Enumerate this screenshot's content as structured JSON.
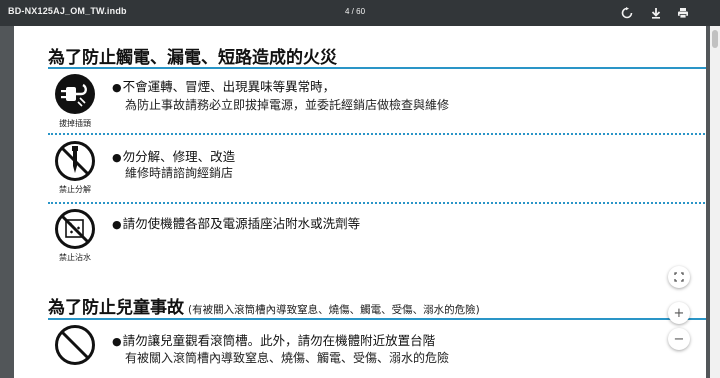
{
  "toolbar": {
    "doc_title": "BD-NX125AJ_OM_TW.indb",
    "page_indicator": "4 / 60",
    "rotate_icon": "rotate-icon",
    "download_icon": "download-icon",
    "print_icon": "print-icon"
  },
  "page": {
    "section1": {
      "heading": "為了防止觸電、漏電、短路造成的火災",
      "items": [
        {
          "icon": "unplug-icon",
          "icon_label": "拔掉插頭",
          "bullet": "●",
          "line1": "不會運轉、冒煙、出現異味等異常時，",
          "line2": "為防止事故請務必立即拔掉電源，並委託經銷店做檢查與維修"
        },
        {
          "icon": "no-disassembly-icon",
          "icon_label": "禁止分解",
          "bullet": "●",
          "line1": "勿分解、修理、改造",
          "line2": "維修時請諮詢經銷店"
        },
        {
          "icon": "no-water-icon",
          "icon_label": "禁止沾水",
          "bullet": "●",
          "line1": "請勿使機體各部及電源插座沾附水或洗劑等",
          "line2": ""
        }
      ]
    },
    "section2": {
      "heading": "為了防止兒童事故",
      "heading_note": "(有被關入滾筒槽內導致窒息、燒傷、觸電、受傷、溺水的危險)",
      "items": [
        {
          "icon": "prohibited-icon",
          "bullet": "●",
          "line1": "請勿讓兒童觀看滾筒槽。此外，請勿在機體附近放置台階",
          "line2": "有被關入滾筒槽內導致窒息、燒傷、觸電、受傷、溺水的危險"
        }
      ]
    }
  },
  "controls": {
    "fit_icon": "fit-page-icon",
    "zoom_in_label": "+",
    "zoom_out_label": "−"
  },
  "colors": {
    "accent_rule": "#2a95c7",
    "toolbar_bg": "#323639",
    "viewer_bg": "#525659"
  }
}
